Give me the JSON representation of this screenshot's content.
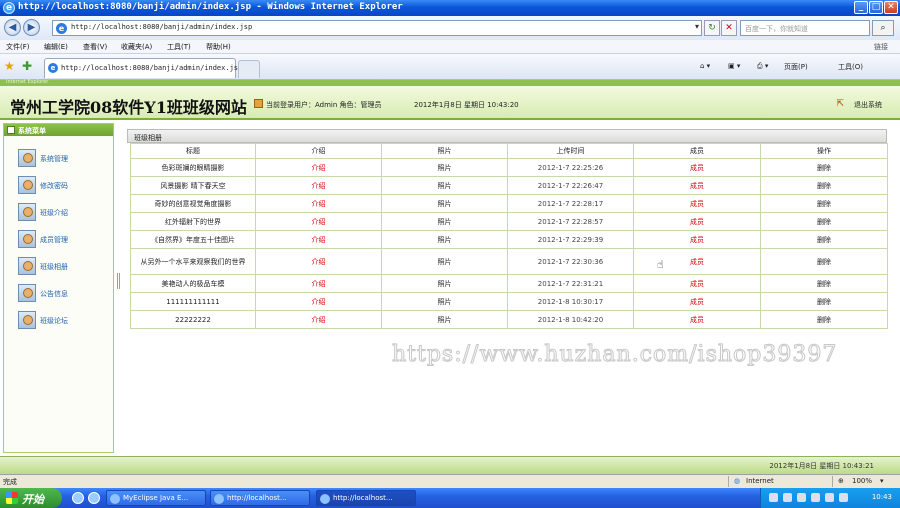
{
  "window": {
    "title": "http://localhost:8080/banji/admin/index.jsp - Windows Internet Explorer",
    "min": "_",
    "max": "□",
    "close": "✕"
  },
  "address": {
    "url": "http://localhost:8080/banji/admin/index.jsp",
    "search_placeholder": "百度一下，你就知道"
  },
  "menu": [
    "文件(F)",
    "编辑(E)",
    "查看(V)",
    "收藏夹(A)",
    "工具(T)",
    "帮助(H)"
  ],
  "menu_links": "链接",
  "tab": {
    "label": "http://localhost:8080/banji/admin/index.jsp"
  },
  "commands": {
    "page": "页面(P)",
    "tools": "工具(O)"
  },
  "header": {
    "strip_text": "Internet Explorer",
    "site_title": "常州工学院08软件Y1班班级网站",
    "user_info": "当前登录用户：Admin  角色：管理员",
    "date_info": "2012年1月8日  星期日  10:43:20",
    "logout": "退出系统"
  },
  "sidebar": {
    "title": "系统菜单",
    "items": [
      {
        "label": "系统管理"
      },
      {
        "label": "修改密码"
      },
      {
        "label": "班级介绍"
      },
      {
        "label": "成员管理"
      },
      {
        "label": "班级相册"
      },
      {
        "label": "公告信息"
      },
      {
        "label": "班级论坛"
      }
    ]
  },
  "content": {
    "section_title": "班级相册",
    "columns": [
      "标题",
      "介绍",
      "照片",
      "上传时间",
      "成员",
      "操作"
    ],
    "rows": [
      {
        "title": "色彩斑斓的眼睛摄影",
        "intro": "介绍",
        "photo": "照片",
        "time": "2012-1-7 22:25:26",
        "member": "成员",
        "action": "删除"
      },
      {
        "title": "风景摄影 晴下春天空",
        "intro": "介绍",
        "photo": "照片",
        "time": "2012-1-7 22:26:47",
        "member": "成员",
        "action": "删除"
      },
      {
        "title": "奇妙的创意视觉角度摄影",
        "intro": "介绍",
        "photo": "照片",
        "time": "2012-1-7 22:28:17",
        "member": "成员",
        "action": "删除"
      },
      {
        "title": "红外辐射下的世界",
        "intro": "介绍",
        "photo": "照片",
        "time": "2012-1-7 22:28:57",
        "member": "成员",
        "action": "删除"
      },
      {
        "title": "《自然界》年度五十佳图片",
        "intro": "介绍",
        "photo": "照片",
        "time": "2012-1-7 22:29:39",
        "member": "成员",
        "action": "删除"
      },
      {
        "title": "从另外一个水平来观察我们的世界",
        "intro": "介绍",
        "photo": "照片",
        "time": "2012-1-7 22:30:36",
        "member": "成员",
        "action": "删除"
      },
      {
        "title": "美艳动人的极品车模",
        "intro": "介绍",
        "photo": "照片",
        "time": "2012-1-7 22:31:21",
        "member": "成员",
        "action": "删除"
      },
      {
        "title": "111111111111",
        "intro": "介绍",
        "photo": "照片",
        "time": "2012-1-8 10:30:17",
        "member": "成员",
        "action": "删除"
      },
      {
        "title": "22222222",
        "intro": "介绍",
        "photo": "照片",
        "time": "2012-1-8 10:42:20",
        "member": "成员",
        "action": "删除"
      }
    ]
  },
  "watermark": "https://www.huzhan.com/ishop39397",
  "footer": {
    "text": "2012年1月8日  星期日  10:43:21"
  },
  "status": {
    "left": "完成",
    "zone": "Internet",
    "zoom": "100%"
  },
  "taskbar": {
    "start": "开始",
    "tasks": [
      "MyEclipse Java E...",
      "http://localhost...",
      "http://localhost..."
    ],
    "clock": "10:43"
  },
  "colors": {
    "header_green": "#d8ecb1",
    "accent_green": "#7ab03a",
    "link_red": "#d40000",
    "ie_blue": "#0a57d8"
  }
}
